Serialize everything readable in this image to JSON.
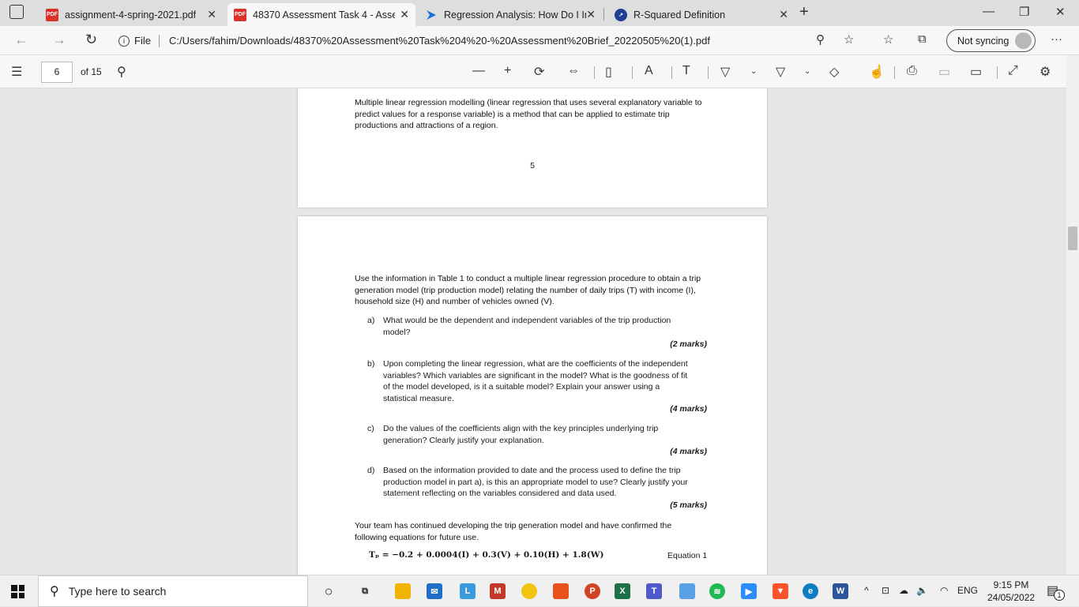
{
  "tabs": [
    {
      "label": "assignment-4-spring-2021.pdf",
      "icon": "pdf-icon"
    },
    {
      "label": "48370 Assessment Task 4 - Asses",
      "icon": "pdf-icon"
    },
    {
      "label": "Regression Analysis: How Do I In",
      "icon": "arrow-logo-icon"
    },
    {
      "label": "R-Squared Definition",
      "icon": "site-logo-icon"
    }
  ],
  "address": {
    "prefix": "File",
    "url": "C:/Users/fahim/Downloads/48370%20Assessment%20Task%204%20-%20Assessment%20Brief_20220505%20(1).pdf",
    "sync": "Not syncing"
  },
  "pdf": {
    "page": "6",
    "of": "of 15"
  },
  "page5": {
    "text": "Multiple linear regression modelling (linear regression that uses several explanatory variable to predict values for a response variable) is a method that can be applied to estimate trip productions and attractions of a region.",
    "number": "5"
  },
  "page6": {
    "intro": "Use the information in Table 1 to conduct a multiple linear regression procedure to obtain a trip generation model (trip production model) relating the number of daily trips (T) with income (I), household size (H) and number of vehicles owned (V).",
    "items": [
      {
        "letter": "a)",
        "text": "What would be the dependent and independent variables of the trip production model?",
        "marks": "(2 marks)"
      },
      {
        "letter": "b)",
        "text": "Upon completing the linear regression, what are the coefficients of the independent variables? Which variables are significant in the model? What is the goodness of fit of the model developed, is it a suitable model? Explain your answer using a statistical measure.",
        "marks": "(4 marks)"
      },
      {
        "letter": "c)",
        "text": "Do the values of the coefficients align with the key principles underlying trip generation? Clearly justify your explanation.",
        "marks": "(4 marks)"
      },
      {
        "letter": "d)",
        "text": "Based on the information provided to date and the process used to define the trip production model in part a), is this an appropriate model to use? Clearly justify your statement reflecting on the variables considered and data used.",
        "marks": "(5 marks)"
      }
    ],
    "continue": "Your team has continued developing the trip generation model and have confirmed the following equations for future use.",
    "equation": "Tₚ = −0.2 + 0.0004(I) + 0.3(V) + 0.10(H) + 1.8(W)",
    "equation_label": "Equation 1"
  },
  "taskbar": {
    "search": "Type here to search",
    "lang": "ENG",
    "time": "9:15 PM",
    "date": "24/05/2022",
    "notif": "1"
  }
}
